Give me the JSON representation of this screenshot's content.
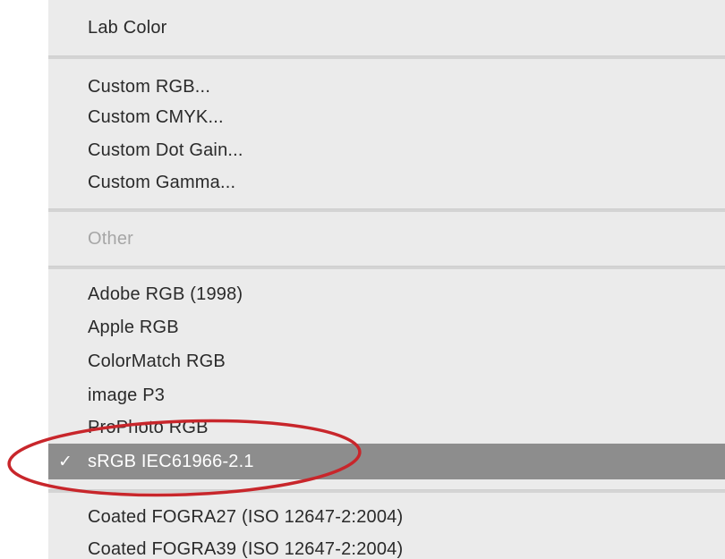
{
  "menu": {
    "items": [
      {
        "label": "Lab Color"
      },
      {
        "label": "Custom RGB..."
      },
      {
        "label": "Custom CMYK..."
      },
      {
        "label": "Custom Dot Gain..."
      },
      {
        "label": "Custom Gamma..."
      },
      {
        "label": "Other",
        "disabled": true
      },
      {
        "label": "Adobe RGB (1998)"
      },
      {
        "label": "Apple RGB"
      },
      {
        "label": "ColorMatch RGB"
      },
      {
        "label": "image P3"
      },
      {
        "label": "ProPhoto RGB"
      },
      {
        "label": "sRGB IEC61966-2.1",
        "selected": true,
        "check": "✓"
      },
      {
        "label": "Coated FOGRA27 (ISO 12647-2:2004)"
      },
      {
        "label": "Coated FOGRA39 (ISO 12647-2:2004)"
      }
    ]
  },
  "colors": {
    "menu_background": "#ebebeb",
    "selected_background": "#8d8d8d",
    "disabled_text": "#a6a6a6",
    "annotation_circle": "#c8262b"
  }
}
